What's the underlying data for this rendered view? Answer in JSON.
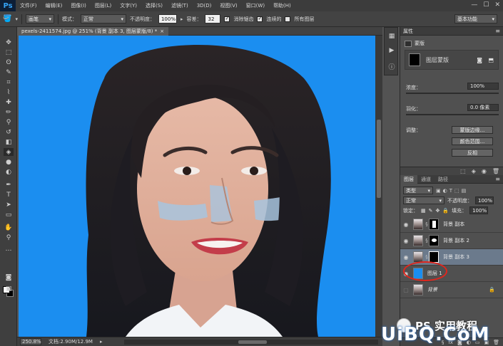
{
  "app": {
    "logo": "Ps"
  },
  "menu": [
    "文件(F)",
    "编辑(E)",
    "图像(I)",
    "图层(L)",
    "文字(Y)",
    "选择(S)",
    "滤镜(T)",
    "3D(D)",
    "视图(V)",
    "窗口(W)",
    "帮助(H)"
  ],
  "window_controls": [
    "—",
    "☐",
    "✕"
  ],
  "options": {
    "preset": "画笔",
    "mode_label": "模式：",
    "mode_value": "正常",
    "opacity_label": "不透明度：",
    "opacity_value": "100%",
    "tolerance_label": "容差：",
    "tolerance_value": "32",
    "antialias_label": "消除锯齿",
    "contiguous_label": "连续的",
    "all_layers_label": "所有图层",
    "workspace": "基本功能"
  },
  "document": {
    "tab_title": "pexels-2411574.jpg @ 251% (背景 副本 3, 图层蒙版/8) *",
    "close": "×"
  },
  "status": {
    "zoom": "250.8%",
    "doc_info": "文档:2.90M/12.9M"
  },
  "properties": {
    "header": "属性",
    "subtitle": "蒙版",
    "mask_type": "图层蒙版",
    "density_label": "浓度：",
    "density_value": "100%",
    "feather_label": "羽化：",
    "feather_value": "0.0 像素",
    "adjust_label": "调整：",
    "btn_mask_edge": "蒙版边缘...",
    "btn_color_range": "颜色范围...",
    "btn_invert": "反相"
  },
  "layers_panel": {
    "tabs": [
      "图层",
      "通道",
      "路径"
    ],
    "kind_label": "类型",
    "blend": "正常",
    "opacity_label": "不透明度：",
    "opacity_value": "100%",
    "lock_label": "锁定：",
    "fill_label": "填充：",
    "fill_value": "100%",
    "layers": [
      {
        "name": "背景 副本",
        "selected": false
      },
      {
        "name": "背景 副本 2",
        "selected": false
      },
      {
        "name": "背景 副本 3",
        "selected": true
      },
      {
        "name": "图层 1",
        "selected": false
      },
      {
        "name": "背景",
        "selected": false
      }
    ]
  },
  "watermark": {
    "text1": "PS 实用教程",
    "text2": "UiBQ.CoM"
  },
  "colors": {
    "canvas_blue": "#1b8ef0",
    "selected_layer": "#6b7a8c",
    "ring_red": "#e0261d"
  }
}
